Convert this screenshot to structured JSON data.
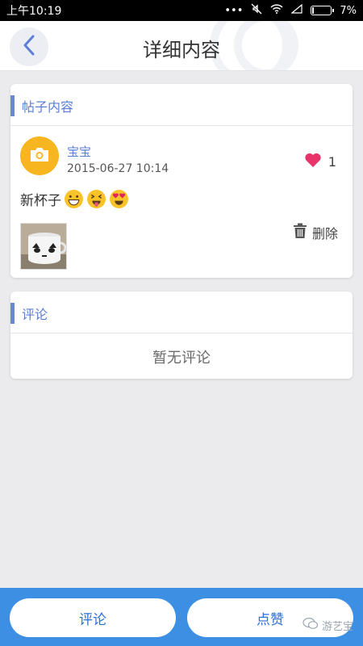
{
  "status": {
    "time": "上午10:19",
    "signal": "•••",
    "battery_text": "7%",
    "battery_level": 0.07
  },
  "header": {
    "title": "详细内容"
  },
  "post": {
    "section_title": "帖子内容",
    "author": "宝宝",
    "date": "2015-06-27 10:14",
    "like_count": "1",
    "text": "新杯子",
    "emojis": [
      "grinning-face",
      "squinting-tongue-face",
      "heart-eyes-face"
    ],
    "delete_label": "删除"
  },
  "comments": {
    "section_title": "评论",
    "empty_text": "暂无评论"
  },
  "bottom": {
    "comment_label": "评论",
    "like_label": "点赞",
    "watermark": "游艺宝"
  },
  "colors": {
    "accent": "#5a7ed3",
    "bottom_bar": "#3d8fe3",
    "heart": "#e8336b",
    "avatar": "#f7b51f"
  }
}
